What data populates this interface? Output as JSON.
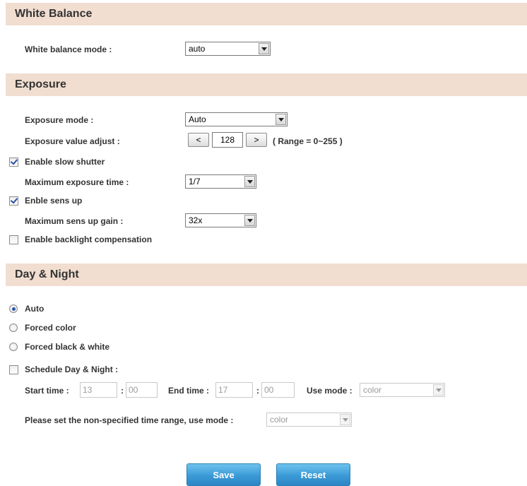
{
  "white_balance": {
    "title": "White Balance",
    "mode_label": "White balance mode :",
    "mode_value": "auto"
  },
  "exposure": {
    "title": "Exposure",
    "mode_label": "Exposure mode :",
    "mode_value": "Auto",
    "value_adjust_label": "Exposure value adjust :",
    "decrement_label": "<",
    "value": "128",
    "increment_label": ">",
    "range_text": "( Range = 0~255 )",
    "slow_shutter_label": "Enable slow shutter",
    "slow_shutter_checked": true,
    "max_exposure_label": "Maximum exposure time :",
    "max_exposure_value": "1/7",
    "sens_up_label": "Enble sens up",
    "sens_up_checked": true,
    "max_sens_up_label": "Maximum sens up gain :",
    "max_sens_up_value": "32x",
    "backlight_label": "Enable backlight compensation",
    "backlight_checked": false
  },
  "day_night": {
    "title": "Day & Night",
    "options": [
      {
        "label": "Auto",
        "selected": true
      },
      {
        "label": "Forced color",
        "selected": false
      },
      {
        "label": "Forced black & white",
        "selected": false
      }
    ],
    "schedule_label": "Schedule Day & Night :",
    "schedule_checked": false,
    "start_time_label": "Start time :",
    "start_hour": "13",
    "start_minute": "00",
    "end_time_label": "End time :",
    "end_hour": "17",
    "end_minute": "00",
    "colon": ":",
    "use_mode_label": "Use mode :",
    "use_mode_value": "color",
    "non_specified_label": "Please set the non-specified time range, use mode :",
    "non_specified_value": "color"
  },
  "actions": {
    "save_label": "Save",
    "reset_label": "Reset"
  },
  "colors": {
    "header_bg": "#f1ded0",
    "button_blue": "#3a9ad6",
    "check_blue": "#2a55a8"
  }
}
